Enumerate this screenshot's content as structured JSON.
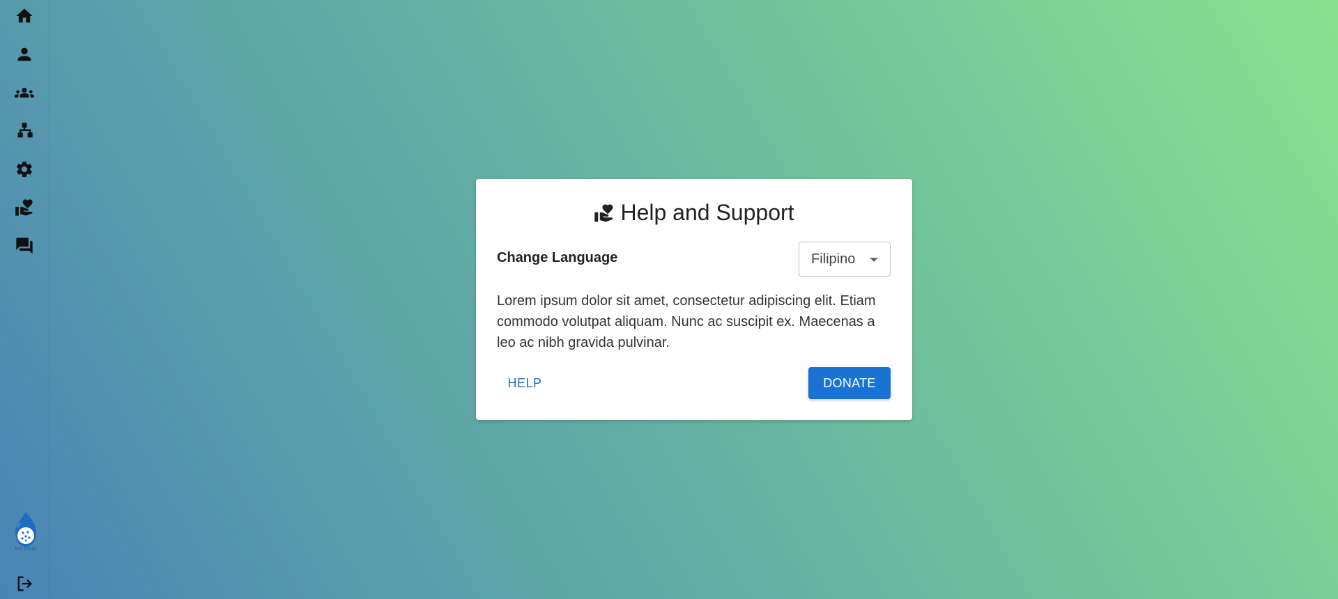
{
  "sidebar": {
    "items": [
      {
        "icon": "home-icon"
      },
      {
        "icon": "person-icon"
      },
      {
        "icon": "groups-icon"
      },
      {
        "icon": "org-chart-icon"
      },
      {
        "icon": "gear-icon"
      },
      {
        "icon": "hand-heart-icon"
      },
      {
        "icon": "chat-icon"
      }
    ],
    "logo_text": "RE.NEW",
    "logout_icon": "logout-icon"
  },
  "dialog": {
    "title_icon": "hand-heart-icon",
    "title": "Help and Support",
    "language_label": "Change Language",
    "language_value": "Filipino",
    "body": "Lorem ipsum dolor sit amet, consectetur adipiscing elit. Etiam commodo volutpat aliquam. Nunc ac suscipit ex. Maecenas a leo ac nibh gravida pulvinar.",
    "help_label": "HELP",
    "donate_label": "DONATE"
  },
  "colors": {
    "accent": "#1a73d2",
    "gradient_start": "#4a84b5",
    "gradient_end": "#88e28e"
  }
}
